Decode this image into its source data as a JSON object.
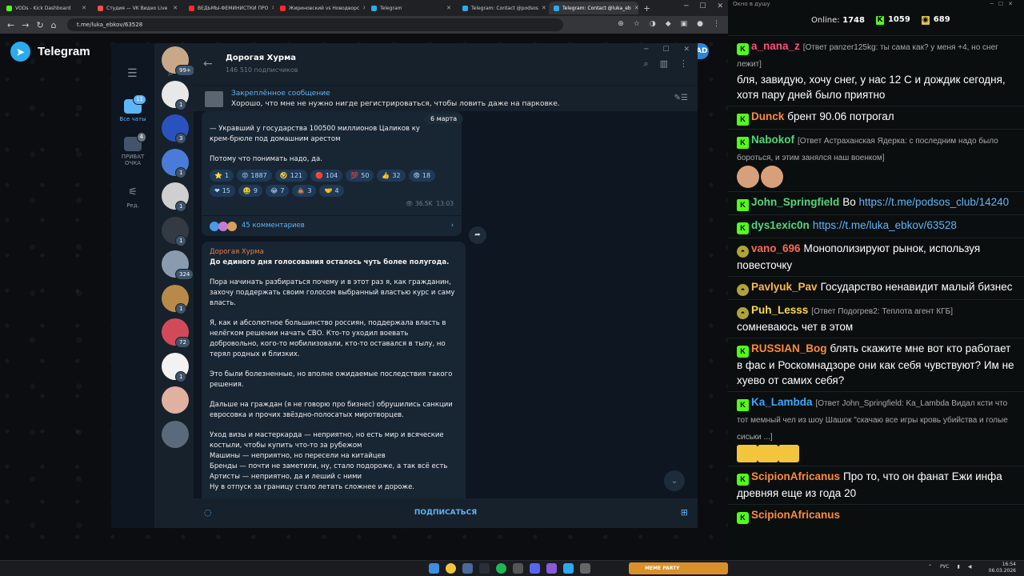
{
  "browser": {
    "tabs": [
      {
        "label": "VODs - Kick Dashboard",
        "color": "#53fc18"
      },
      {
        "label": "Студия — VK Видео Live",
        "color": "#ff4b4b"
      },
      {
        "label": "ВЕДЬМЫ-ФЕМИНИСТКИ ПРО",
        "color": "#ff2a2a"
      },
      {
        "label": "Жириновский vs Новодворс",
        "color": "#ff2a2a"
      },
      {
        "label": "Telegram",
        "color": "#2aabee"
      },
      {
        "label": "Telegram: Contact @podsos",
        "color": "#2aabee"
      },
      {
        "label": "Telegram: Contact @luka_eb",
        "color": "#2aabee"
      }
    ],
    "url": "t.me/luka_ebkov/63528"
  },
  "page": {
    "brand": "Telegram",
    "pill_label": "AD"
  },
  "telegram": {
    "folders": [
      {
        "label": "Все чаты",
        "badge": "11",
        "active": true
      },
      {
        "label": "ПРИВАТ ОЧКА",
        "badge": "4",
        "active": false
      },
      {
        "label": "Ред.",
        "badge": "",
        "active": false
      }
    ],
    "chat_list": [
      {
        "count": "99+",
        "color": "#c9a88a"
      },
      {
        "count": "1",
        "color": "#e8e8e8"
      },
      {
        "count": "3",
        "color": "#2a52be"
      },
      {
        "count": "1",
        "color": "#4a7bd8"
      },
      {
        "count": "1",
        "color": "#cfcfcf"
      },
      {
        "count": "1",
        "color": "#333a44"
      },
      {
        "count": "324",
        "color": "#8a9bb0"
      },
      {
        "count": "1",
        "color": "#b88a4a"
      },
      {
        "count": "72",
        "color": "#d24a5a"
      },
      {
        "count": "1",
        "color": "#f2f2f2"
      },
      {
        "count": "",
        "color": "#e0b0a0"
      },
      {
        "count": "",
        "color": "#5a6a7a"
      }
    ],
    "channel": {
      "title": "Дорогая Хурма",
      "subscribers": "146 510 подписчиков"
    },
    "pinned": {
      "title": "Закреплённое сообщение",
      "text": "Хорошо, что мне не нужно нигде регистрироваться, чтобы ловить даже на парковке."
    },
    "date_pill": "6 марта",
    "post1": {
      "text1": "— Укравший у государства 100500 миллионов Цаликов ку",
      "text2": "крем-брюле под домашним арестом",
      "text3": "Потому что понимать надо, да.",
      "reactions": [
        {
          "icon": "⭐",
          "count": "1"
        },
        {
          "icon": "😡",
          "count": "1887"
        },
        {
          "icon": "🤣",
          "count": "121"
        },
        {
          "icon": "🔴",
          "count": "104"
        },
        {
          "icon": "💯",
          "count": "50"
        },
        {
          "icon": "👍",
          "count": "32"
        },
        {
          "icon": "😨",
          "count": "18"
        },
        {
          "icon": "❤",
          "count": "15"
        },
        {
          "icon": "🤮",
          "count": "9"
        },
        {
          "icon": "😂",
          "count": "7"
        },
        {
          "icon": "💩",
          "count": "3"
        },
        {
          "icon": "🤝",
          "count": "4"
        }
      ],
      "views": "36.5K",
      "time": "13:03",
      "comments": "45 комментариев"
    },
    "post2": {
      "author": "Дорогая Хурма",
      "title": "До единого дня голосования осталось чуть более полугода.",
      "p1": "Пора начинать разбираться почему и в этот раз я, как гражданин, захочу поддержать своим голосом выбранный властью курс и саму власть.",
      "p2": "Я, как и абсолютное большинство россиян, поддержала власть в нелёгком решении начать СВО. Кто-то уходил воевать добровольно, кого-то мобилизовали, кто-то оставался в тылу, но терял родных и близких.",
      "p3": "Это были болезненные, но вполне ожидаемые последствия такого решения.",
      "p4": "Дальше на граждан (я не говорю про бизнес) обрушились санкции евросовка и прочих звёздно-полосатых миротворцев.",
      "l1": "Уход визы и мастеркарда — неприятно, но есть мир и всяческие костыли, чтобы купить что-то за рубежом",
      "l2": "Машины — неприятно, но пересели на китайцев",
      "l3": "Бренды — почти не заметили, ну, стало подороже, а так всё есть",
      "l4": "Артисты — неприятно, да и леший с ними",
      "l5": "Ну в отпуск за границу стало летать сложнее и дороже."
    },
    "subscribe": "ПОДПИСАТЬСЯ"
  },
  "stream": {
    "top_label": "Окно в душу",
    "online_label": "Online:",
    "online": "1748",
    "kick_count": "1059",
    "other_count": "689",
    "messages": [
      {
        "user": "a_nana_z",
        "color": "#ff4f7a",
        "reply": "[Ответ panzer125kg: ты сама как? у меня +4, но снег лежит]",
        "text": "бля, завидую, хочу снег, у нас 12 С и дождик сегодня, хотя пару дней было приятно",
        "badges": "kb"
      },
      {
        "user": "Dunck",
        "color": "#ff8a3c",
        "reply": "",
        "text": "брент 90.06 потрогал",
        "badges": "sb"
      },
      {
        "user": "Nabokof",
        "color": "#53d77a",
        "reply": "[Ответ Астраханская Ядерка: с последним надо было бороться, и этим занялся наш военком]",
        "text": "",
        "badges": "sb"
      },
      {
        "user": "John_Springfield",
        "color": "#53d77a",
        "reply": "",
        "text": "Во ",
        "link": "https://t.me/podsos_club/14240",
        "badges": "sb"
      },
      {
        "user": "dys1exic0n",
        "color": "#53d77a",
        "reply": "",
        "text": "",
        "link": "https://t.me/luka_ebkov/63528",
        "badges": "kb"
      },
      {
        "user": "vano_696",
        "color": "#ff6a4a",
        "reply": "",
        "text": "Монополизируют рынок, используя повесточку",
        "badges": "hat"
      },
      {
        "user": "Pavlyuk_Pav",
        "color": "#ffb84a",
        "reply": "",
        "text": "Государство ненавидит малый бизнес",
        "badges": "hat"
      },
      {
        "user": "Puh_Lesss",
        "color": "#ffd84a",
        "reply": "[Ответ Подогрев2: Теплота агент КГБ]",
        "text": "сомневаюсь чет в этом",
        "badges": "hat"
      },
      {
        "user": "RUSSIAN_Bog",
        "color": "#ff8a3c",
        "reply": "",
        "text": "блять скажите мне вот кто работает в фас и Роскомнадзоре они как себя чувствуют? Им не хуево от самих себя?",
        "badges": "kb"
      },
      {
        "user": "Ka_Lambda",
        "color": "#3ca8ff",
        "reply": "[Ответ John_Springfield: Ka_Lambda Видал ксти что тот мемный чел из шоу Шашок \"скачаю все игры кровь убийства и голые сиськи ...]",
        "text": "",
        "badges": "sb"
      },
      {
        "user": "ScipionAfricanus",
        "color": "#ff8a3c",
        "reply": "",
        "text": "Про то, что он фанат Ежи инфа древняя еще из года 20",
        "badges": "kb"
      },
      {
        "user": "ScipionAfricanus",
        "color": "#ff8a3c",
        "reply": "",
        "text": "",
        "badges": "kb"
      }
    ]
  },
  "taskbar": {
    "game_label": "MEME PARTY",
    "lang": "РУС",
    "time": "16:54",
    "date": "06.03.2026"
  }
}
